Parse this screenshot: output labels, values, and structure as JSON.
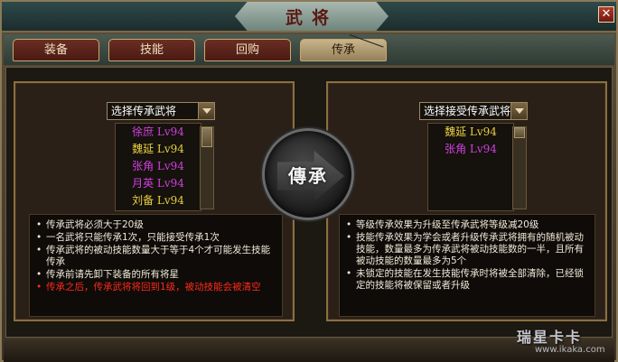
{
  "window": {
    "title": "武将"
  },
  "tabs": [
    {
      "label": "装备",
      "active": false
    },
    {
      "label": "技能",
      "active": false
    },
    {
      "label": "回购",
      "active": false
    },
    {
      "label": "传承",
      "active": true
    }
  ],
  "left_panel": {
    "select_label": "选择传承武将",
    "generals": [
      {
        "name": "徐庶 Lv94",
        "color": "#d040e0"
      },
      {
        "name": "魏延 Lv94",
        "color": "#e8d040"
      },
      {
        "name": "张角 Lv94",
        "color": "#d040e0"
      },
      {
        "name": "月英 Lv94",
        "color": "#d040e0"
      },
      {
        "name": "刘备 Lv94",
        "color": "#e8d040"
      }
    ],
    "rules": [
      {
        "text": "传承武将必须大于20级",
        "warn": false
      },
      {
        "text": "一名武将只能传承1次，只能接受传承1次",
        "warn": false
      },
      {
        "text": "传承武将的被动技能数量大于等于4个才可能发生技能传承",
        "warn": false
      },
      {
        "text": "传承前请先卸下装备的所有将星",
        "warn": false
      },
      {
        "text": "传承之后，传承武将将回到1级，被动技能会被清空",
        "warn": true
      }
    ]
  },
  "transfer_button": {
    "label": "傳承"
  },
  "right_panel": {
    "select_label": "选择接受传承武将",
    "generals": [
      {
        "name": "魏延 Lv94",
        "color": "#e8d040"
      },
      {
        "name": "张角 Lv94",
        "color": "#d040e0"
      }
    ],
    "rules": [
      {
        "text": "等级传承效果为升级至传承武将等级减20级",
        "warn": false
      },
      {
        "text": "技能传承效果为学会或者升级传承武将拥有的随机被动技能，数量最多为传承武将被动技能数的一半，且所有被动技能的数量最多为5个",
        "warn": false
      },
      {
        "text": "未锁定的技能在发生技能传承时将被全部清除，已经锁定的技能将被保留或者升级",
        "warn": false
      }
    ]
  },
  "watermark": {
    "text": "瑞星卡卡",
    "url": "www.ikaka.com"
  }
}
